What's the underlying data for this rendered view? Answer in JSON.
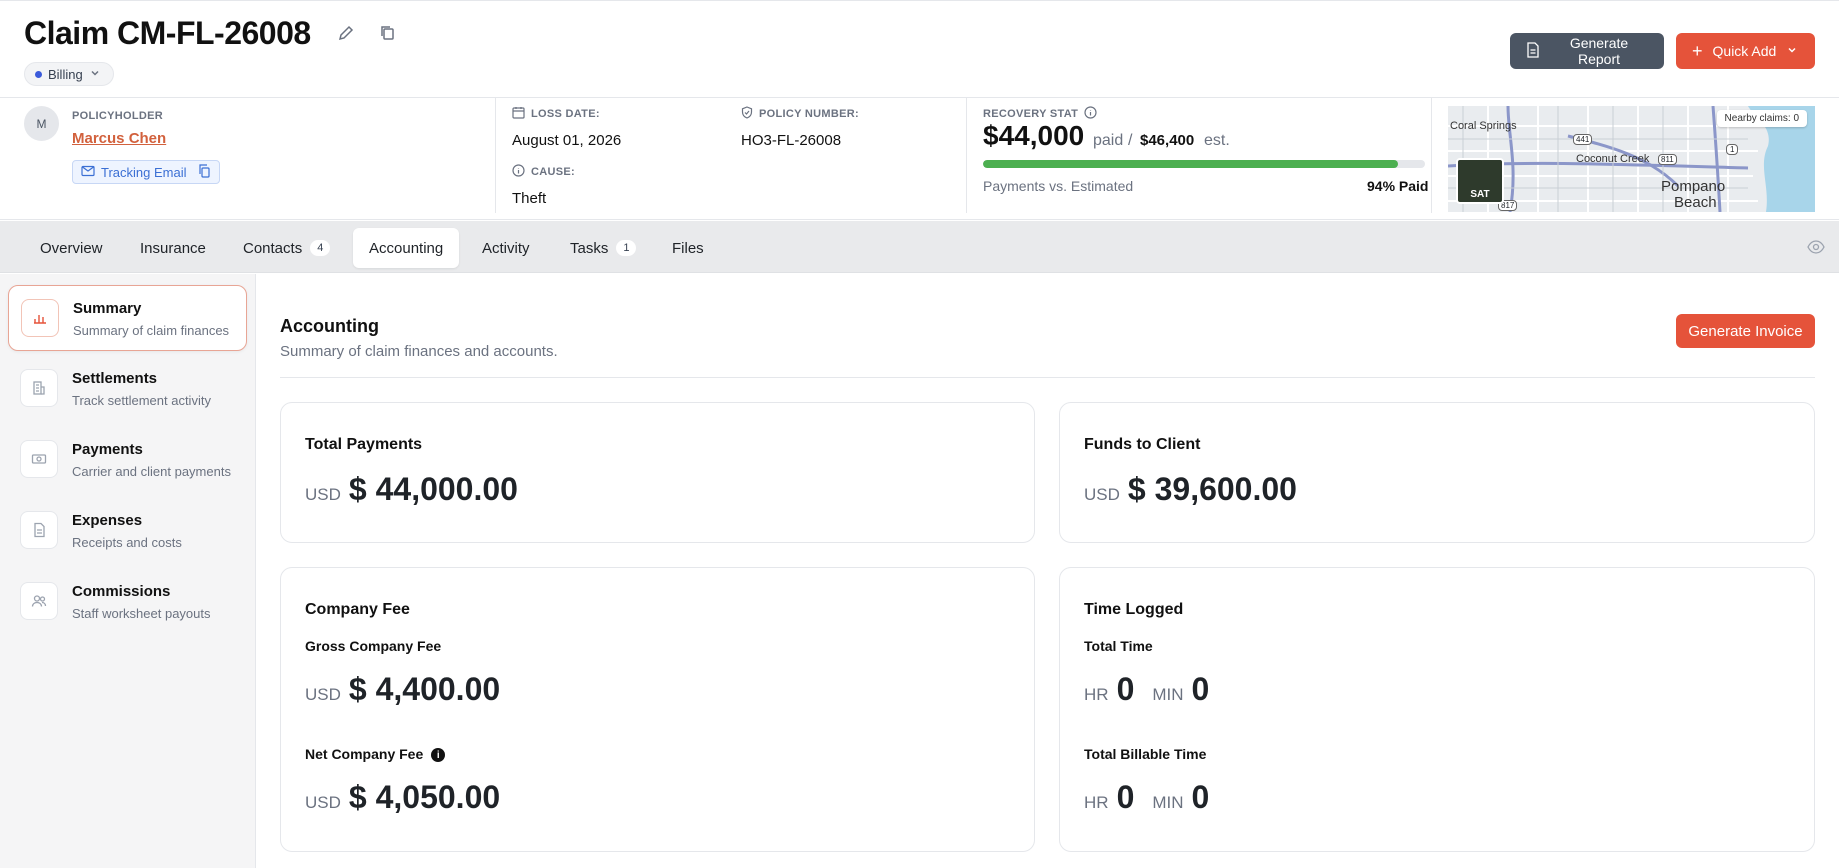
{
  "header": {
    "title": "Claim CM-FL-26008",
    "status": "Billing",
    "generate_report": "Generate Report",
    "quick_add": "Quick Add"
  },
  "policyholder": {
    "label": "POLICYHOLDER",
    "avatar_initial": "M",
    "name": "Marcus Chen",
    "tracking_email": "Tracking Email"
  },
  "loss": {
    "label": "LOSS DATE:",
    "value": "August 01, 2026"
  },
  "policy": {
    "label": "POLICY NUMBER:",
    "value": "HO3-FL-26008"
  },
  "cause": {
    "label": "CAUSE:",
    "value": "Theft"
  },
  "recovery": {
    "label": "RECOVERY STAT",
    "paid": "$44,000",
    "paid_word": "paid",
    "slash": "/",
    "estimated": "$46,400",
    "est_word": "est.",
    "bar_label": "Payments vs. Estimated",
    "percent_label": "94% Paid",
    "percent": 94
  },
  "map": {
    "nearby": "Nearby claims: 0",
    "sat": "SAT",
    "place_coral": "Coral Springs",
    "place_coconut": "Coconut Creek",
    "place_pompano_1": "Pompano",
    "place_pompano_2": "Beach",
    "shield_441": "441",
    "shield_811": "811",
    "shield_1": "1",
    "shield_817": "817"
  },
  "tabs": [
    {
      "label": "Overview"
    },
    {
      "label": "Insurance"
    },
    {
      "label": "Contacts",
      "count": "4"
    },
    {
      "label": "Accounting"
    },
    {
      "label": "Activity"
    },
    {
      "label": "Tasks",
      "count": "1"
    },
    {
      "label": "Files"
    }
  ],
  "sidebar": [
    {
      "title": "Summary",
      "sub": "Summary of claim finances"
    },
    {
      "title": "Settlements",
      "sub": "Track settlement activity"
    },
    {
      "title": "Payments",
      "sub": "Carrier and client payments"
    },
    {
      "title": "Expenses",
      "sub": "Receipts and costs"
    },
    {
      "title": "Commissions",
      "sub": "Staff worksheet payouts"
    }
  ],
  "main": {
    "title": "Accounting",
    "subtitle": "Summary of claim finances and accounts.",
    "invoice_button": "Generate Invoice"
  },
  "cards": {
    "total_payments": {
      "title": "Total Payments",
      "unit": "USD",
      "amount": "$ 44,000.00"
    },
    "funds_to_client": {
      "title": "Funds to Client",
      "unit": "USD",
      "amount": "$ 39,600.00"
    },
    "company_fee": {
      "title": "Company Fee",
      "gross_label": "Gross Company Fee",
      "gross_unit": "USD",
      "gross_amount": "$ 4,400.00",
      "net_label": "Net Company Fee",
      "net_unit": "USD",
      "net_amount": "$ 4,050.00"
    },
    "time_logged": {
      "title": "Time Logged",
      "total_label": "Total Time",
      "billable_label": "Total Billable Time",
      "hr_unit": "HR",
      "min_unit": "MIN",
      "total_hr": "0",
      "total_min": "0",
      "billable_hr": "0",
      "billable_min": "0"
    }
  }
}
